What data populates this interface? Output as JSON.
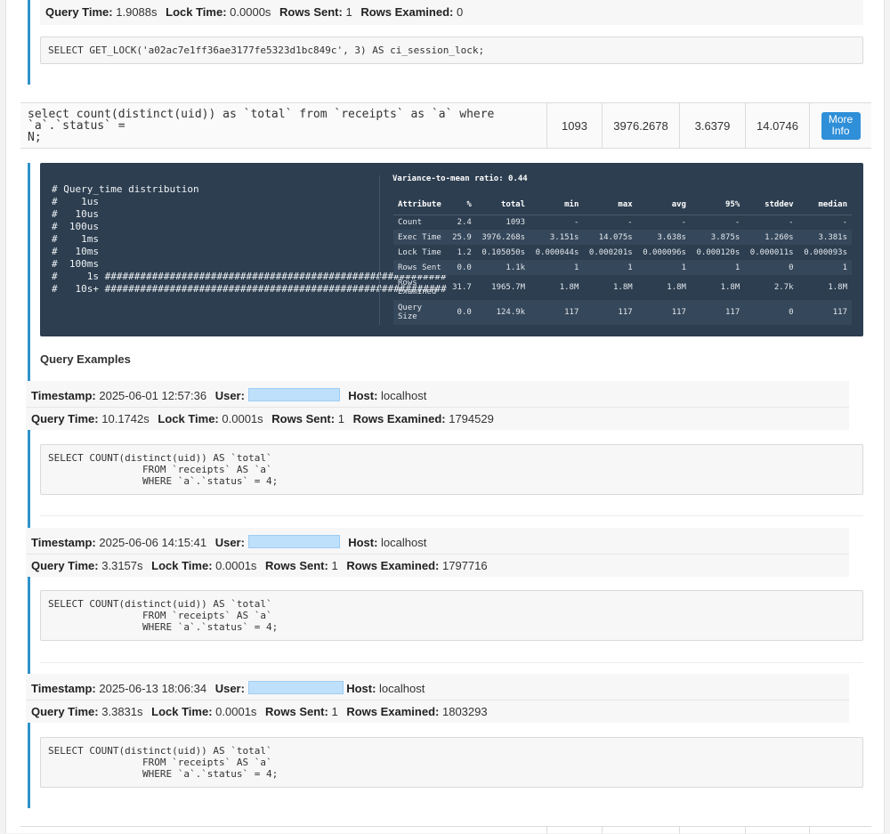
{
  "prev_example": {
    "query_time_label": "Query Time:",
    "query_time": "1.9088s",
    "lock_time_label": "Lock Time:",
    "lock_time": "0.0000s",
    "rows_sent_label": "Rows Sent:",
    "rows_sent": "1",
    "rows_examined_label": "Rows Examined:",
    "rows_examined": "0",
    "sql": "SELECT GET_LOCK('a02ac7e1ff36ae3177fe5323d1bc849c', 3) AS ci_session_lock;"
  },
  "query_row": {
    "query": "select count(distinct(uid)) as `total` from `receipts` as `a` where `a`.`status` =\nN;",
    "count": "1093",
    "total": "3976.2678",
    "avg": "3.6379",
    "max": "14.0746",
    "more_label": "More Info"
  },
  "distribution": {
    "histogram": "# Query_time distribution\n#    1us\n#   10us\n#  100us\n#    1ms\n#   10ms\n#  100ms\n#     1s ##########################################################\n#   10s+ ##########################################################",
    "variance_ratio": "Variance-to-mean ratio: 0.44",
    "headers": [
      "Attribute",
      "%",
      "total",
      "min",
      "max",
      "avg",
      "95%",
      "stddev",
      "median"
    ],
    "rows": [
      [
        "Count",
        "2.4",
        "1093",
        "-",
        "-",
        "-",
        "-",
        "-",
        "-"
      ],
      [
        "Exec Time",
        "25.9",
        "3976.268s",
        "3.151s",
        "14.075s",
        "3.638s",
        "3.875s",
        "1.260s",
        "3.381s"
      ],
      [
        "Lock Time",
        "1.2",
        "0.105050s",
        "0.000044s",
        "0.000201s",
        "0.000096s",
        "0.000120s",
        "0.000011s",
        "0.000093s"
      ],
      [
        "Rows Sent",
        "0.0",
        "1.1k",
        "1",
        "1",
        "1",
        "1",
        "0",
        "1"
      ],
      [
        "Rows\nExamined",
        "31.7",
        "1965.7M",
        "1.8M",
        "1.8M",
        "1.8M",
        "1.8M",
        "2.7k",
        "1.8M"
      ],
      [
        "Query\nSize",
        "0.0",
        "124.9k",
        "117",
        "117",
        "117",
        "117",
        "0",
        "117"
      ]
    ]
  },
  "examples_title": "Query Examples",
  "labels": {
    "timestamp": "Timestamp:",
    "user": "User:",
    "host": "Host:",
    "query_time": "Query Time:",
    "lock_time": "Lock Time:",
    "rows_sent": "Rows Sent:",
    "rows_examined": "Rows Examined:"
  },
  "examples": [
    {
      "timestamp": "2025-06-01 12:57:36",
      "host": "localhost",
      "query_time": "10.1742s",
      "lock_time": "0.0001s",
      "rows_sent": "1",
      "rows_examined": "1794529",
      "sql": "SELECT COUNT(distinct(uid)) AS `total`\n                FROM `receipts` AS `a`\n                WHERE `a`.`status` = 4;"
    },
    {
      "timestamp": "2025-06-06 14:15:41",
      "host": "localhost",
      "query_time": "3.3157s",
      "lock_time": "0.0001s",
      "rows_sent": "1",
      "rows_examined": "1797716",
      "sql": "SELECT COUNT(distinct(uid)) AS `total`\n                FROM `receipts` AS `a`\n                WHERE `a`.`status` = 4;"
    },
    {
      "timestamp": "2025-06-13 18:06:34",
      "host": "localhost",
      "query_time": "3.3831s",
      "lock_time": "0.0001s",
      "rows_sent": "1",
      "rows_examined": "1803293",
      "sql": "SELECT COUNT(distinct(uid)) AS `total`\n                FROM `receipts` AS `a`\n                WHERE `a`.`status` = 4;"
    }
  ]
}
